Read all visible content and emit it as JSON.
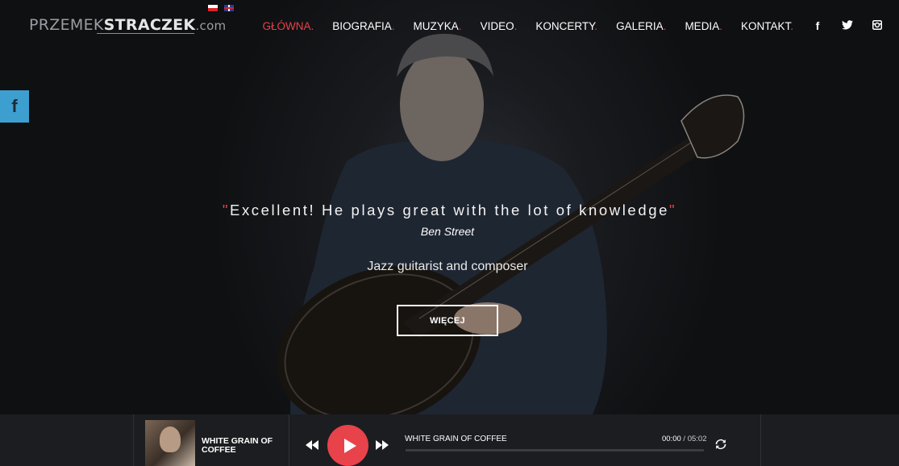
{
  "logo": {
    "part1": "PRZEMEK",
    "part2": "STRACZEK",
    "part3": ".com"
  },
  "flags": [
    {
      "icon": "poland-flag-icon"
    },
    {
      "icon": "uk-flag-icon"
    }
  ],
  "nav": {
    "items": [
      {
        "label": "GŁÓWNA",
        "dot": ".",
        "active": true
      },
      {
        "label": "BIOGRAFIA",
        "dot": "."
      },
      {
        "label": "MUZYKA",
        "dot": "."
      },
      {
        "label": "VIDEO",
        "dot": "."
      },
      {
        "label": "KONCERTY",
        "dot": "."
      },
      {
        "label": "GALERIA",
        "dot": "."
      },
      {
        "label": "MEDIA",
        "dot": "."
      },
      {
        "label": "KONTAKT",
        "dot": "."
      }
    ],
    "social": {
      "facebook": "f",
      "twitter": "twitter-icon",
      "instagram": "instagram-icon"
    }
  },
  "side": {
    "facebook": "f"
  },
  "hero": {
    "quote_open": "\"",
    "quote": "Excellent! He plays great with the lot of knowledge",
    "quote_close": "\"",
    "author": "Ben Street",
    "subtitle": "Jazz guitarist and composer",
    "button": "WIĘCEJ"
  },
  "player": {
    "cover_title": "WHITE GRAIN OF COFFEE",
    "track_title": "WHITE GRAIN OF COFFEE",
    "current": "00:00",
    "separator": " / ",
    "duration": "05:02",
    "progress": 0
  },
  "colors": {
    "accent": "#e8424a",
    "facebook_side": "#3d9fcf",
    "player_bg": "#1c1d20"
  }
}
